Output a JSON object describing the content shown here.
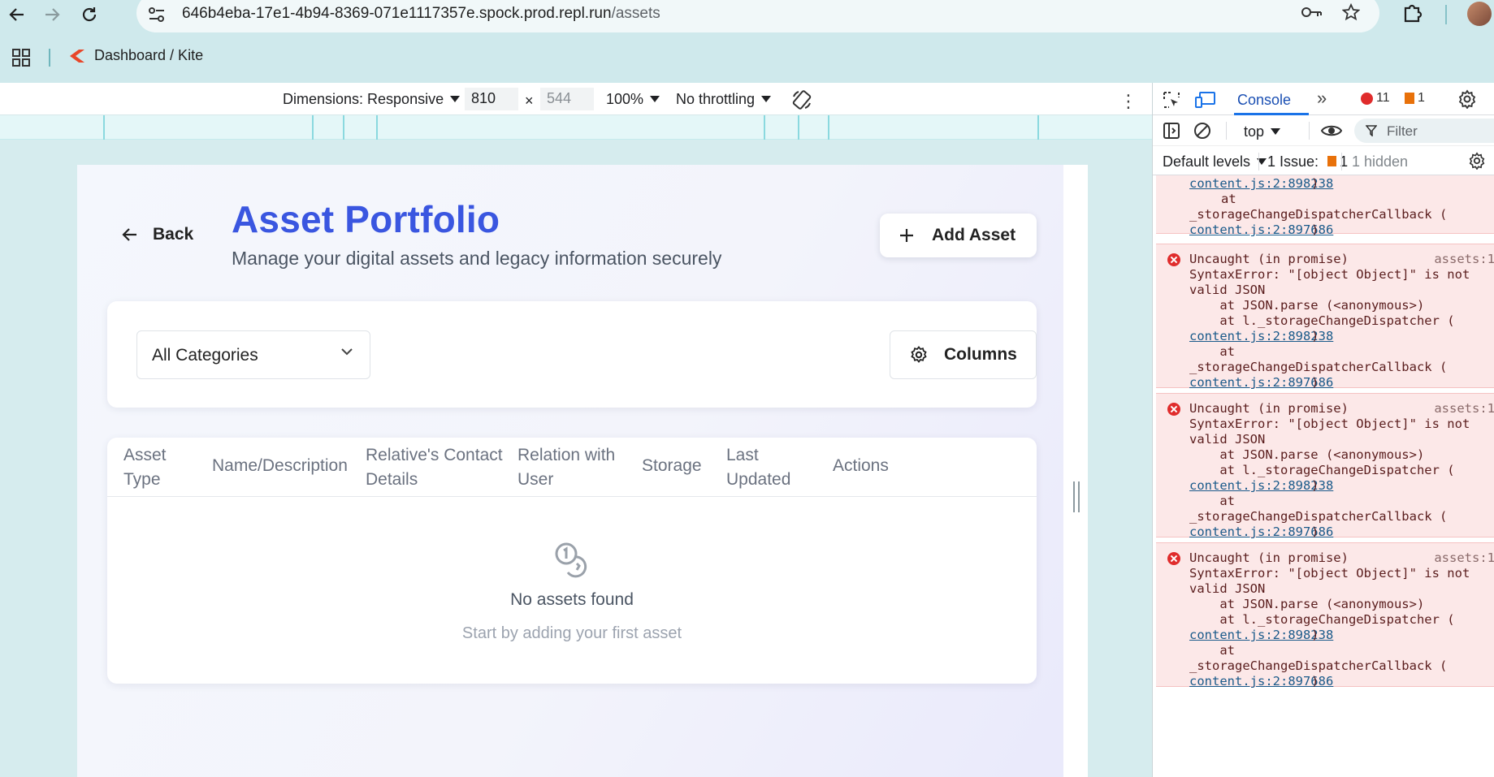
{
  "browser": {
    "url_host": "646b4eba-17e1-4b94-8369-071e1117357e.spock.prod.repl.run",
    "url_path": "/assets",
    "bookmark_label": "Dashboard / Kite"
  },
  "device_toolbar": {
    "dimensions_label": "Dimensions: Responsive",
    "width": "810",
    "times": "×",
    "height": "544",
    "zoom": "100%",
    "throttling": "No throttling"
  },
  "page": {
    "back_label": "Back",
    "title": "Asset Portfolio",
    "subtitle": "Manage your digital assets and legacy information securely",
    "add_asset_label": "Add Asset",
    "category_select_value": "All Categories",
    "columns_label": "Columns",
    "table_headers": [
      [
        "Asset",
        "Type"
      ],
      [
        "Name/Description",
        ""
      ],
      [
        "Relative's Contact",
        "Details"
      ],
      [
        "Relation with",
        "User"
      ],
      [
        "Storage",
        ""
      ],
      [
        "Last",
        "Updated"
      ],
      [
        "Actions",
        ""
      ]
    ],
    "empty_title": "No assets found",
    "empty_subtitle": "Start by adding your first asset"
  },
  "devtools": {
    "console_tab": "Console",
    "error_count": "11",
    "warning_count": "1",
    "context": "top",
    "filter_placeholder": "Filter",
    "levels": "Default levels",
    "issues_label": "1 Issue:",
    "issues_count": "1",
    "hidden_label": "1 hidden",
    "partial_entry": {
      "link1": "content.js:2:898238",
      "at": "at",
      "callback": "_storageChangeDispatcherCallback (",
      "link2": "content.js:2:897686"
    },
    "errors": [
      {
        "head": "Uncaught (in promise)",
        "source": "assets:1",
        "msg1": "SyntaxError: \"[object Object]\" is not",
        "msg2": "valid JSON",
        "at1": "    at JSON.parse (<anonymous>)",
        "at2": "    at l._storageChangeDispatcher (",
        "link1": "content.js:2:898238",
        "at3": "    at",
        "callback": "_storageChangeDispatcherCallback (",
        "link2": "content.js:2:897686"
      },
      {
        "head": "Uncaught (in promise)",
        "source": "assets:1",
        "msg1": "SyntaxError: \"[object Object]\" is not",
        "msg2": "valid JSON",
        "at1": "    at JSON.parse (<anonymous>)",
        "at2": "    at l._storageChangeDispatcher (",
        "link1": "content.js:2:898238",
        "at3": "    at",
        "callback": "_storageChangeDispatcherCallback (",
        "link2": "content.js:2:897686"
      },
      {
        "head": "Uncaught (in promise)",
        "source": "assets:1",
        "msg1": "SyntaxError: \"[object Object]\" is not",
        "msg2": "valid JSON",
        "at1": "    at JSON.parse (<anonymous>)",
        "at2": "    at l._storageChangeDispatcher (",
        "link1": "content.js:2:898238",
        "at3": "    at",
        "callback": "_storageChangeDispatcherCallback (",
        "link2": "content.js:2:897686"
      }
    ]
  },
  "colors": {
    "accent": "#3a56e0",
    "chrome_bg": "#cfe9ec",
    "error_bg": "#fce8e8"
  }
}
